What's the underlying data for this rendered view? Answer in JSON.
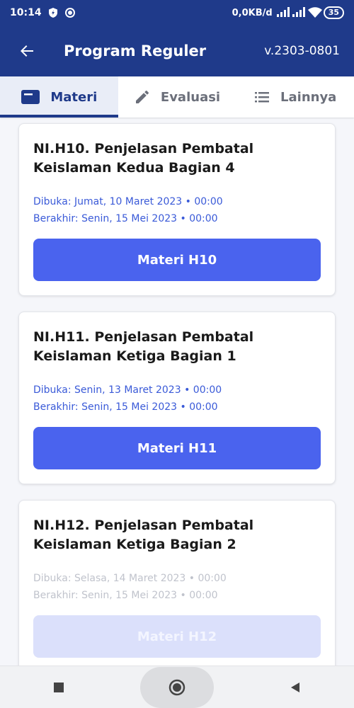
{
  "status_bar": {
    "time": "10:14",
    "network_speed": "0,0KB/d",
    "battery": "35"
  },
  "app_bar": {
    "title": "Program Reguler",
    "version": "v.2303-0801"
  },
  "tabs": [
    {
      "label": "Materi",
      "icon": "book-icon",
      "active": true
    },
    {
      "label": "Evaluasi",
      "icon": "pencil-icon",
      "active": false
    },
    {
      "label": "Lainnya",
      "icon": "list-icon",
      "active": false
    }
  ],
  "cards": [
    {
      "title": "NI.H10. Penjelasan Pembatal Keislaman Kedua Bagian 4",
      "opened": "Dibuka: Jumat, 10 Maret 2023 • 00:00",
      "ended": "Berakhir: Senin, 15 Mei 2023 • 00:00",
      "button": "Materi H10",
      "enabled": true
    },
    {
      "title": "NI.H11. Penjelasan Pembatal Keislaman Ketiga Bagian 1",
      "opened": "Dibuka: Senin, 13 Maret 2023 • 00:00",
      "ended": "Berakhir: Senin, 15 Mei 2023 • 00:00",
      "button": "Materi H11",
      "enabled": true
    },
    {
      "title": "NI.H12. Penjelasan Pembatal Keislaman Ketiga Bagian 2",
      "opened": "Dibuka: Selasa, 14 Maret 2023 • 00:00",
      "ended": "Berakhir: Senin, 15 Mei 2023 • 00:00",
      "button": "Materi H12",
      "enabled": false
    }
  ],
  "colors": {
    "primary": "#1f3a8a",
    "button": "#4a63ee",
    "button_disabled": "#dbe0fb",
    "date_text": "#3a5ad8"
  }
}
